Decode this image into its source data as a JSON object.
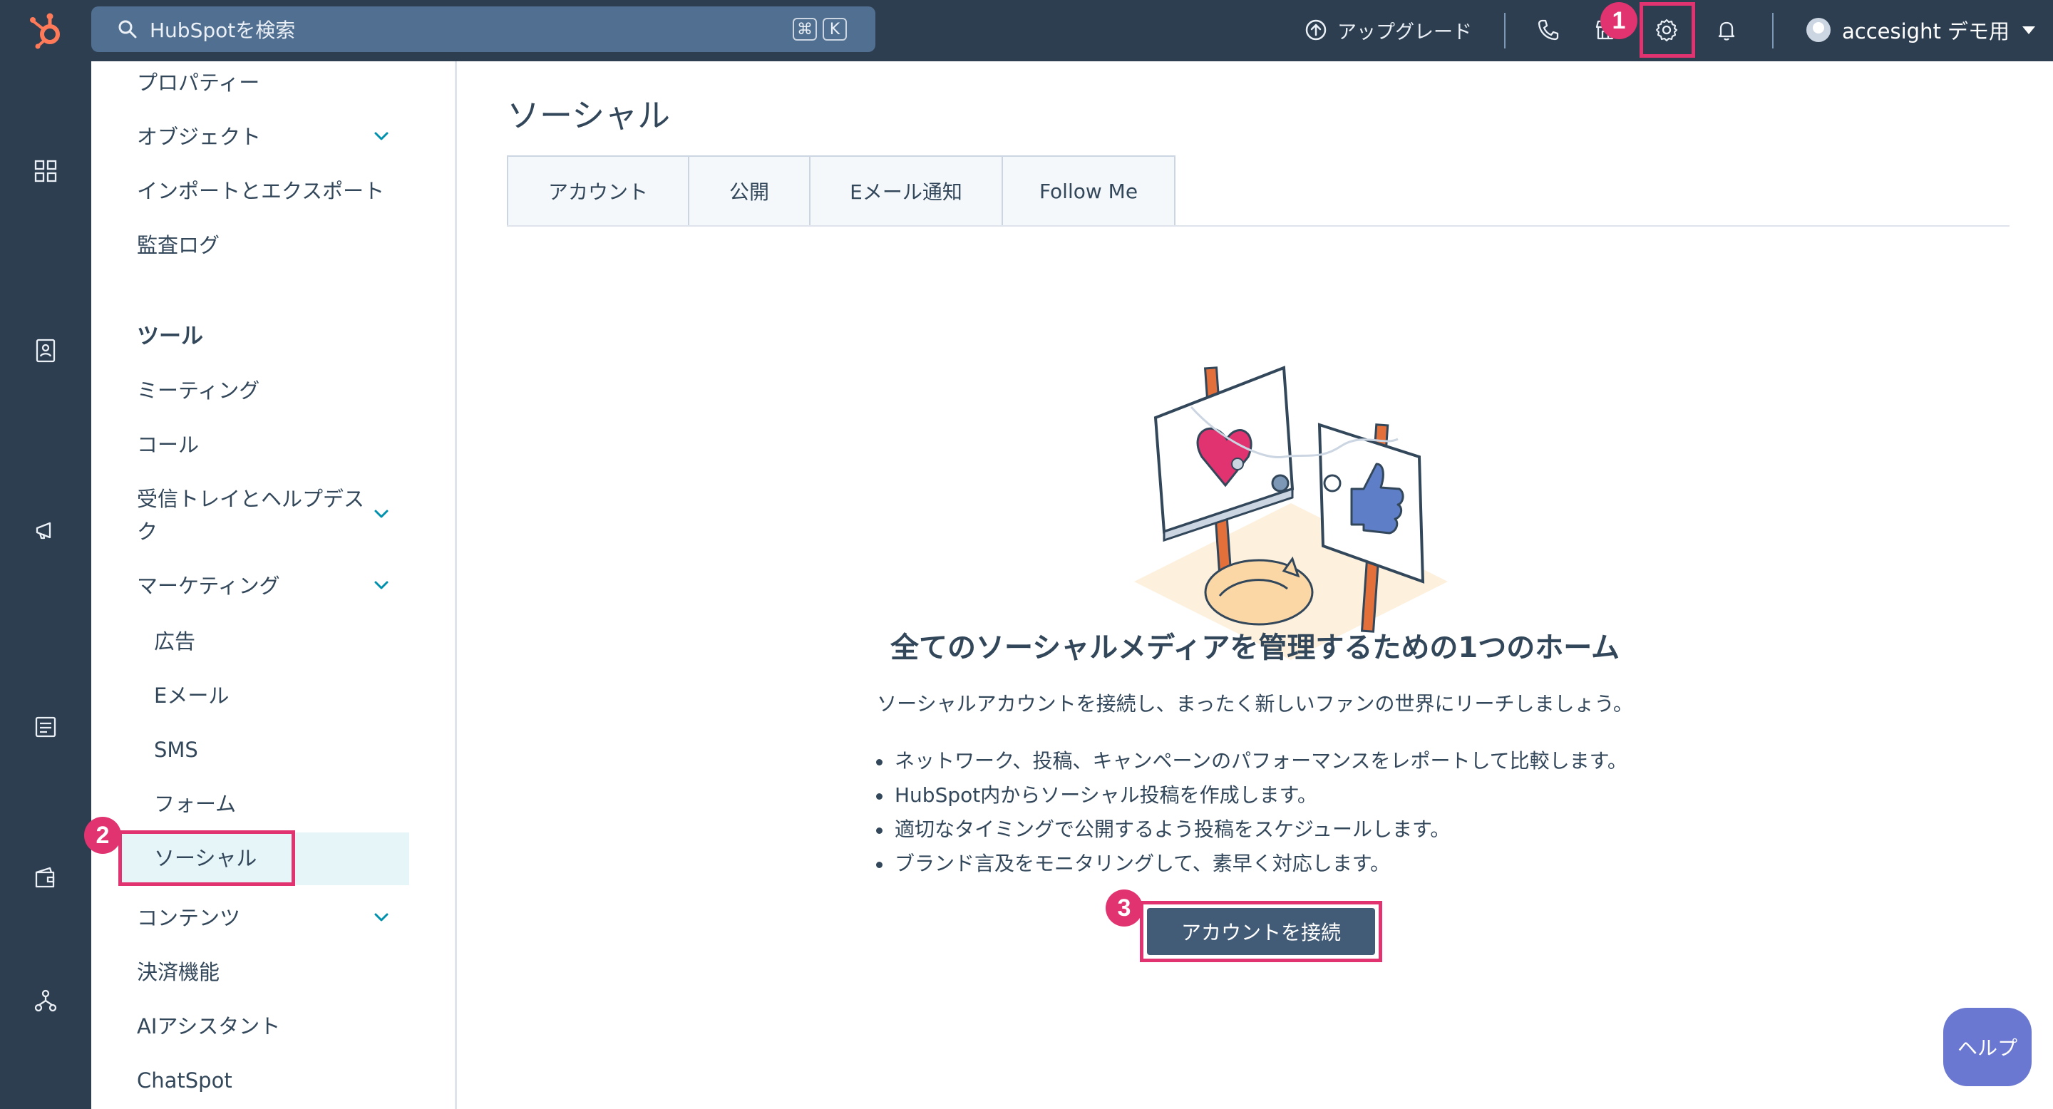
{
  "topbar": {
    "search_placeholder": "HubSpotを検索",
    "kbd_cmd": "⌘",
    "kbd_k": "K",
    "upgrade_label": "アップグレード",
    "user_name": "accesight デモ用",
    "badge_1": "1",
    "icons": [
      "sprocket-logo-icon",
      "search-icon",
      "upgrade-arrow-icon",
      "phone-icon",
      "marketplace-icon",
      "gear-icon",
      "bell-icon",
      "avatar",
      "caret-down-icon"
    ]
  },
  "rail": {
    "icons": [
      "grid-icon",
      "contacts-icon",
      "megaphone-icon",
      "content-icon",
      "wallet-icon",
      "automation-icon"
    ]
  },
  "sidebar": {
    "items": [
      {
        "label": "プロパティー"
      },
      {
        "label": "オブジェクト"
      },
      {
        "label": "インポートとエクスポート"
      },
      {
        "label": "監査ログ"
      },
      {
        "label": "ツール"
      },
      {
        "label": "ミーティング"
      },
      {
        "label": "コール"
      },
      {
        "label": "受信トレイとヘルプデス",
        "label2": "ク"
      },
      {
        "label": "マーケティング"
      },
      {
        "label": "広告"
      },
      {
        "label": "Eメール"
      },
      {
        "label": "SMS"
      },
      {
        "label": "フォーム"
      },
      {
        "label": "ソーシャル"
      },
      {
        "label": "コンテンツ"
      },
      {
        "label": "決済機能"
      },
      {
        "label": "AIアシスタント"
      },
      {
        "label": "ChatSpot"
      }
    ],
    "badge_2": "2"
  },
  "main": {
    "title": "ソーシャル",
    "tabs": [
      {
        "label": "アカウント"
      },
      {
        "label": "公開"
      },
      {
        "label": "Eメール通知"
      },
      {
        "label": "Follow Me"
      }
    ],
    "headline": "全てのソーシャルメディアを管理するための1つのホーム",
    "subtext": "ソーシャルアカウントを接続し、まったく新しいファンの世界にリーチしましょう。",
    "bullets": [
      "ネットワーク、投稿、キャンペーンのパフォーマンスをレポートして比較します。",
      "HubSpot内からソーシャル投稿を作成します。",
      "適切なタイミングで公開するよう投稿をスケジュールします。",
      "ブランド言及をモニタリングして、素早く対応します。"
    ],
    "cta_label": "アカウントを接続",
    "badge_3": "3"
  },
  "help_label": "ヘルプ",
  "colors": {
    "nav_bg": "#2d3e50",
    "search_bg": "#516f90",
    "highlight": "#e0336f",
    "cta_bg": "#425b76",
    "help_bg": "#6a78d1",
    "active_item_bg": "#e5f5f8"
  }
}
